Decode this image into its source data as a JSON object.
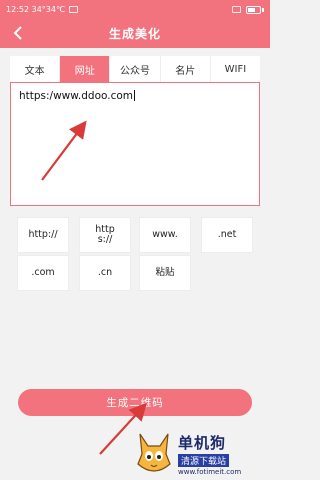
{
  "status_bar": {
    "time": "12:52 34°34℃",
    "battery_percent": 62
  },
  "navbar": {
    "title": "生成美化",
    "back_icon": "chevron-left-icon"
  },
  "tabs": [
    {
      "label": "文本",
      "active": false
    },
    {
      "label": "网址",
      "active": true
    },
    {
      "label": "公众号",
      "active": false
    },
    {
      "label": "名片",
      "active": false
    },
    {
      "label": "WIFI",
      "active": false
    }
  ],
  "input": {
    "value": "https:/www.ddoo.com"
  },
  "quick_inserts": [
    "http://",
    "https://",
    "www.",
    ".net",
    ".com",
    ".cn",
    "粘贴"
  ],
  "generate_button": {
    "label": "生成二维码"
  },
  "watermark": {
    "brand": "单机狗",
    "tagline": "清源下载站",
    "url": "www.fotimeit.com"
  },
  "colors": {
    "accent": "#f2737d",
    "arrow": "#d93a3a"
  }
}
